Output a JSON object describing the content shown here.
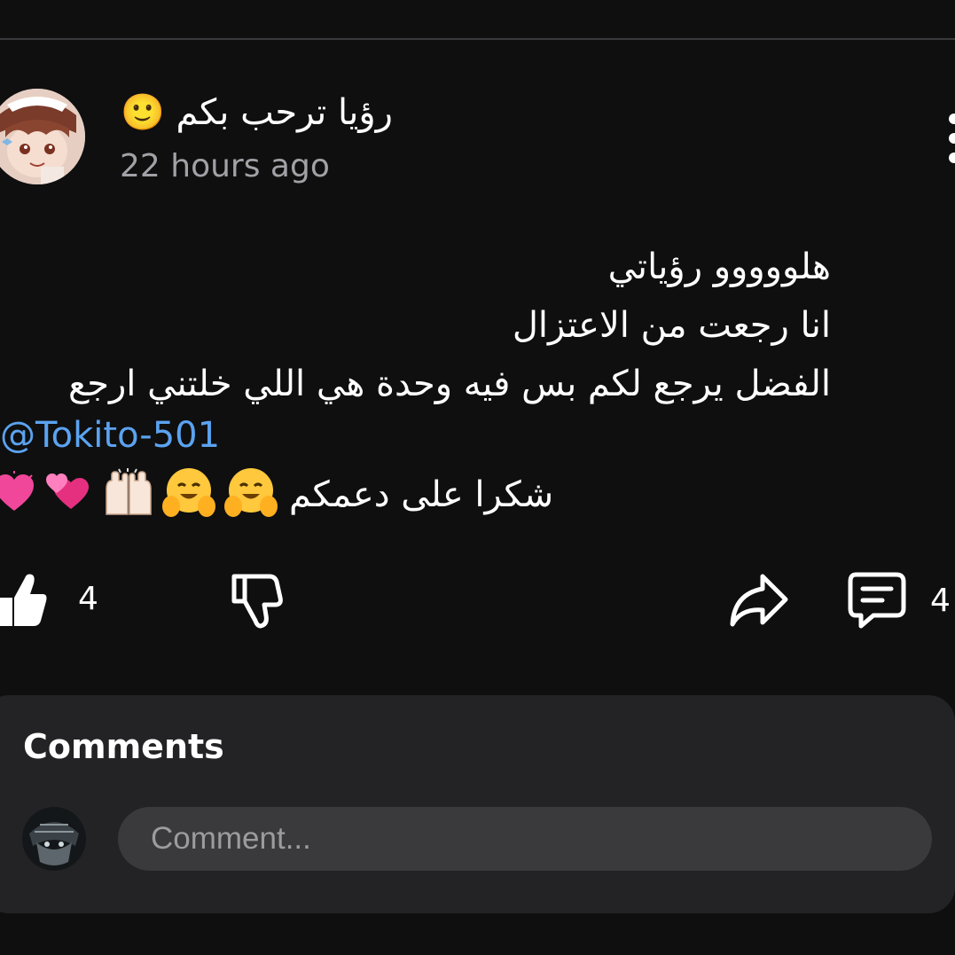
{
  "post": {
    "author": {
      "name": "رؤيا ترحب بكم",
      "name_emoji": "🙂",
      "avatar_icon": "anime-character-avatar"
    },
    "timestamp": "22 hours ago",
    "body_lines": [
      "هلووووو رؤياتي",
      "انا رجعت من الاعتزال",
      "الفضل يرجع لكم بس فيه وحدة هي اللي خلتني ارجع"
    ],
    "mention": "@Tokito-501",
    "thanks": {
      "text": "شكرا على دعمكم",
      "emojis": [
        "💗",
        "💞",
        "🙌",
        "🤗",
        "🤗"
      ]
    },
    "actions": {
      "like_count": "4",
      "comment_count": "4"
    }
  },
  "comments": {
    "title": "Comments",
    "input_placeholder": "Comment...",
    "commenter_avatar_icon": "dark-anime-avatar"
  },
  "colors": {
    "background": "#0f0f10",
    "panel": "#232325",
    "input": "#3a3a3c",
    "mention": "#5ba3f0",
    "secondary_text": "#a1a1a6"
  }
}
